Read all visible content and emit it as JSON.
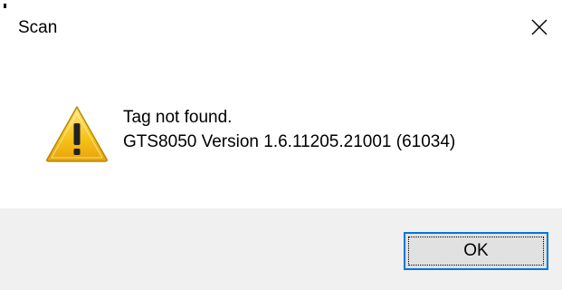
{
  "window": {
    "title": "Scan"
  },
  "titlebar": {
    "close_icon": "close-icon"
  },
  "message": {
    "icon": "warning-icon",
    "line1": "Tag not found.",
    "line2": "GTS8050 Version 1.6.11205.21001 (61034)"
  },
  "buttons": {
    "ok_label": "OK"
  },
  "colors": {
    "content_bg": "#ffffff",
    "footer_bg": "#f0f0f0",
    "button_bg": "#e1e1e1",
    "focus_border": "#0078d7",
    "warning_yellow": "#f7c51b"
  }
}
